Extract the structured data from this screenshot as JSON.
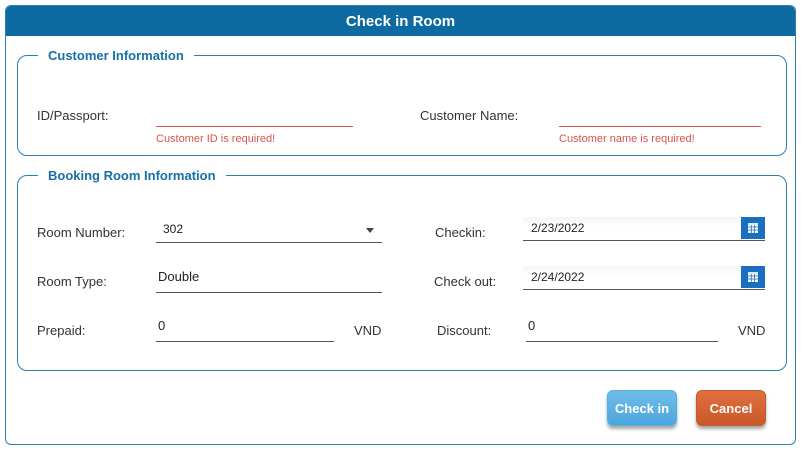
{
  "dialog": {
    "title": "Check in Room"
  },
  "customer_info": {
    "legend": "Customer Information",
    "id_label": "ID/Passport:",
    "id_value": "",
    "id_error": "Customer ID is required!",
    "name_label": "Customer Name:",
    "name_value": "",
    "name_error": "Customer name is required!"
  },
  "booking_info": {
    "legend": "Booking Room Information",
    "room_number_label": "Room Number:",
    "room_number_value": "302",
    "room_type_label": "Room Type:",
    "room_type_value": "Double",
    "prepaid_label": "Prepaid:",
    "prepaid_value": "0",
    "prepaid_unit": "VND",
    "checkin_label": "Checkin:",
    "checkin_value": "2/23/2022",
    "checkout_label": "Check out:",
    "checkout_value": "2/24/2022",
    "discount_label": "Discount:",
    "discount_value": "0",
    "discount_unit": "VND"
  },
  "actions": {
    "checkin_label": "Check in",
    "cancel_label": "Cancel"
  },
  "colors": {
    "title_bar": "#0e6ba1",
    "accent": "#1670a6",
    "error": "#d9534f",
    "checkin_button": "#4ba6dd",
    "cancel_button": "#c9582a"
  },
  "icons": {
    "calendar": "calendar-icon",
    "dropdown": "chevron-down-icon"
  }
}
